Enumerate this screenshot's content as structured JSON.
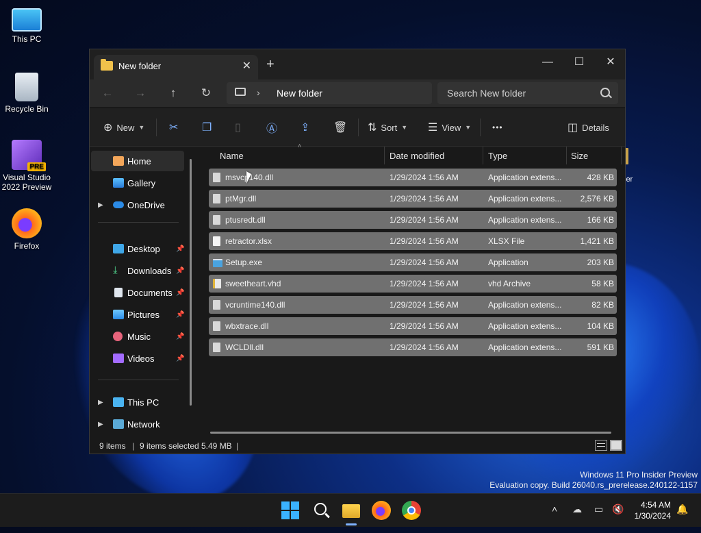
{
  "desktop": {
    "icons": [
      {
        "label": "This PC"
      },
      {
        "label": "Recycle Bin"
      },
      {
        "label_line1": "Visual Studio",
        "label_line2": "2022 Preview",
        "badge": "PRE"
      },
      {
        "label": "Firefox"
      }
    ],
    "watermark_line1": "Windows 11 Pro Insider Preview",
    "watermark_line2": "Evaluation copy. Build 26040.rs_prerelease.240122-1157",
    "peek_text": "ler"
  },
  "window": {
    "tab_title": "New folder",
    "new_tab_symbol": "+",
    "controls": {
      "minimize": "—",
      "maximize": "☐",
      "close": "✕"
    },
    "address_crumb": "New folder",
    "search_placeholder": "Search New folder",
    "commands": {
      "new_label": "New",
      "sort_label": "Sort",
      "view_label": "View",
      "more_label": "•••",
      "details_label": "Details"
    },
    "sidebar": {
      "home": "Home",
      "gallery": "Gallery",
      "onedrive": "OneDrive",
      "desktop": "Desktop",
      "downloads": "Downloads",
      "documents": "Documents",
      "pictures": "Pictures",
      "music": "Music",
      "videos": "Videos",
      "thispc": "This PC",
      "network": "Network"
    },
    "columns": {
      "name": "Name",
      "date": "Date modified",
      "type": "Type",
      "size": "Size"
    },
    "files": [
      {
        "name": "msvcp140.dll",
        "date": "1/29/2024 1:56 AM",
        "type": "Application extens...",
        "size": "428 KB"
      },
      {
        "name": "ptMgr.dll",
        "date": "1/29/2024 1:56 AM",
        "type": "Application extens...",
        "size": "2,576 KB"
      },
      {
        "name": "ptusredt.dll",
        "date": "1/29/2024 1:56 AM",
        "type": "Application extens...",
        "size": "166 KB"
      },
      {
        "name": "retractor.xlsx",
        "date": "1/29/2024 1:56 AM",
        "type": "XLSX File",
        "size": "1,421 KB"
      },
      {
        "name": "Setup.exe",
        "date": "1/29/2024 1:56 AM",
        "type": "Application",
        "size": "203 KB"
      },
      {
        "name": "sweetheart.vhd",
        "date": "1/29/2024 1:56 AM",
        "type": "vhd Archive",
        "size": "58 KB"
      },
      {
        "name": "vcruntime140.dll",
        "date": "1/29/2024 1:56 AM",
        "type": "Application extens...",
        "size": "82 KB"
      },
      {
        "name": "wbxtrace.dll",
        "date": "1/29/2024 1:56 AM",
        "type": "Application extens...",
        "size": "104 KB"
      },
      {
        "name": "WCLDll.dll",
        "date": "1/29/2024 1:56 AM",
        "type": "Application extens...",
        "size": "591 KB"
      }
    ],
    "status": {
      "count": "9 items",
      "selected": "9 items selected",
      "size": "5.49 MB"
    }
  },
  "taskbar": {
    "time": "4:54 AM",
    "date": "1/30/2024"
  },
  "colors": {
    "accent": "#7fb2ff",
    "selected_row": "#707070",
    "folder": "#f0c14b"
  }
}
